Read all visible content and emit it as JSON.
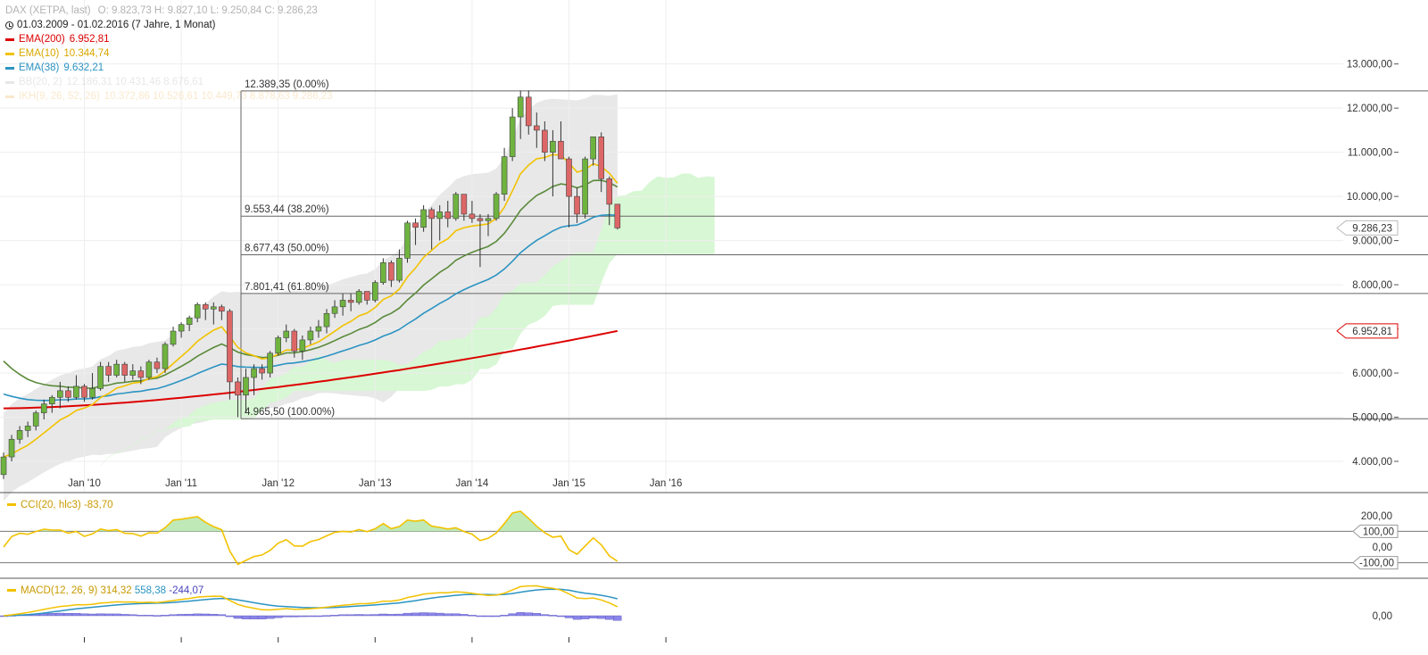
{
  "header": {
    "instrument": "DAX (XETPA, last)",
    "ohlc": "O: 9.823,73  H: 9.827,10  L: 9.250,84  C: 9.286,23",
    "range": "01.03.2009 - 01.02.2016 (7 Jahre, 1 Monat)"
  },
  "legend": [
    {
      "label": "EMA(200)",
      "value": "6.952,81",
      "color": "#dd0000",
      "faded": false
    },
    {
      "label": "EMA(10)",
      "value": "10.344,74",
      "color": "#f2c200",
      "faded": false
    },
    {
      "label": "EMA(38)",
      "value": "9.632,21",
      "color": "#2b93c2",
      "faded": false
    },
    {
      "label": "BB(20, 2)",
      "value": "12.186,31  10.431,46  8.676,61",
      "color": "#bbbbbb",
      "faded": true
    },
    {
      "label": "IKH(9, 26, 52, 26)",
      "value": "10.372,86  10.526,61  10.449,73  8.878,63  9.286,23",
      "color": "#f0c070",
      "faded": true
    }
  ],
  "price_tags": {
    "last": "9.286,23",
    "ema200": "6.952,81"
  },
  "cci": {
    "label": "CCI(20, hlc3)",
    "value": "-83,70",
    "ticks": [
      "200,00",
      "0,00"
    ],
    "tag_hi": "100,00",
    "tag_lo": "-100,00"
  },
  "macd": {
    "label": "MACD(12, 26, 9)",
    "value1": "314,32",
    "value2": "558,38",
    "value3": "-244,07",
    "tick": "0,00"
  },
  "colors": {
    "up": "#6fb33f",
    "down": "#dd6666",
    "ema200": "#dd0000",
    "ema10": "#f2c200",
    "ema38": "#2b93c2",
    "green_line": "#5a8a3a",
    "bb": "#e6e6e6",
    "cloud_up": "#d8f7d4",
    "cloud_down": "#f6d2d2",
    "macd_hist": "#8a85e8",
    "macd_signal": "#2b93c2",
    "cci_fill": "#b8e8b0"
  },
  "chart_data": {
    "type": "candlestick",
    "interval": "monthly",
    "y_ticks": [
      "13.000,00",
      "12.000,00",
      "11.000,00",
      "10.000,00",
      "9.000,00",
      "8.000,00",
      "7.000,00",
      "6.000,00",
      "5.000,00",
      "4.000,00"
    ],
    "y_tick_values": [
      13000,
      12000,
      11000,
      10000,
      9000,
      8000,
      7000,
      6000,
      5000,
      4000
    ],
    "x_labels": [
      "Jan '10",
      "Jan '11",
      "Jan '12",
      "Jan '13",
      "Jan '14",
      "Jan '15",
      "Jan '16"
    ],
    "x_label_month_index": [
      10,
      22,
      34,
      46,
      58,
      70,
      82
    ],
    "fibonacci": [
      {
        "label": "12.389,35 (0.00%)",
        "value": 12389.35
      },
      {
        "label": "9.553,44 (38.20%)",
        "value": 9553.44
      },
      {
        "label": "8.677,43 (50.00%)",
        "value": 8677.43
      },
      {
        "label": "7.801,41 (61.80%)",
        "value": 7801.41
      },
      {
        "label": "4.965,50 (100.00%)",
        "value": 4965.5
      }
    ],
    "candles": [
      [
        3700,
        4200,
        3600,
        4100
      ],
      [
        4100,
        4600,
        4000,
        4500
      ],
      [
        4500,
        4800,
        4400,
        4700
      ],
      [
        4700,
        4900,
        4550,
        4800
      ],
      [
        4800,
        5150,
        4700,
        5100
      ],
      [
        5100,
        5400,
        4950,
        5300
      ],
      [
        5300,
        5500,
        5100,
        5450
      ],
      [
        5450,
        5800,
        5200,
        5600
      ],
      [
        5600,
        5700,
        5350,
        5450
      ],
      [
        5450,
        5950,
        5400,
        5700
      ],
      [
        5700,
        5750,
        5350,
        5450
      ],
      [
        5450,
        6000,
        5400,
        5650
      ],
      [
        5650,
        6250,
        5600,
        6150
      ],
      [
        6150,
        6250,
        5800,
        5950
      ],
      [
        5950,
        6300,
        5900,
        6200
      ],
      [
        6200,
        6250,
        5800,
        5950
      ],
      [
        5950,
        6200,
        5850,
        6050
      ],
      [
        6050,
        6150,
        5750,
        5900
      ],
      [
        5900,
        6300,
        5850,
        6250
      ],
      [
        6250,
        6350,
        6000,
        6100
      ],
      [
        6100,
        6700,
        6000,
        6650
      ],
      [
        6650,
        7050,
        6600,
        6950
      ],
      [
        6950,
        7150,
        6800,
        7100
      ],
      [
        7100,
        7300,
        6950,
        7250
      ],
      [
        7250,
        7600,
        7150,
        7550
      ],
      [
        7550,
        7600,
        7200,
        7450
      ],
      [
        7450,
        7600,
        7100,
        7500
      ],
      [
        7500,
        7550,
        7200,
        7400
      ],
      [
        7400,
        7450,
        5400,
        5800
      ],
      [
        5800,
        5900,
        5000,
        5500
      ],
      [
        5500,
        6100,
        5100,
        5900
      ],
      [
        5900,
        6200,
        5500,
        6100
      ],
      [
        6100,
        6200,
        5850,
        6000
      ],
      [
        6000,
        6500,
        5900,
        6450
      ],
      [
        6450,
        6850,
        6400,
        6800
      ],
      [
        6800,
        7100,
        6700,
        6950
      ],
      [
        6950,
        7000,
        6350,
        6500
      ],
      [
        6500,
        6850,
        6300,
        6750
      ],
      [
        6750,
        7050,
        6650,
        6950
      ],
      [
        6950,
        7200,
        6800,
        7050
      ],
      [
        7050,
        7450,
        6900,
        7350
      ],
      [
        7350,
        7650,
        7250,
        7500
      ],
      [
        7500,
        7800,
        7300,
        7650
      ],
      [
        7650,
        7800,
        7400,
        7600
      ],
      [
        7600,
        7900,
        7550,
        7850
      ],
      [
        7850,
        7850,
        7550,
        7650
      ],
      [
        7650,
        8100,
        7600,
        8050
      ],
      [
        8050,
        8600,
        8000,
        8500
      ],
      [
        8500,
        8550,
        7950,
        8100
      ],
      [
        8100,
        8800,
        8050,
        8600
      ],
      [
        8600,
        9450,
        8500,
        9400
      ],
      [
        9400,
        9500,
        8900,
        9300
      ],
      [
        9300,
        9800,
        9200,
        9700
      ],
      [
        9700,
        9750,
        8800,
        9500
      ],
      [
        9500,
        9800,
        9000,
        9650
      ],
      [
        9650,
        9900,
        9300,
        9500
      ],
      [
        9500,
        10100,
        9450,
        10050
      ],
      [
        10050,
        10050,
        9450,
        9600
      ],
      [
        9600,
        9900,
        9400,
        9500
      ],
      [
        9500,
        9600,
        8400,
        9450
      ],
      [
        9450,
        9600,
        9100,
        9500
      ],
      [
        9500,
        10100,
        9450,
        10050
      ],
      [
        10050,
        11100,
        9900,
        10900
      ],
      [
        10900,
        12000,
        10800,
        11800
      ],
      [
        11800,
        12400,
        11300,
        12250
      ],
      [
        12250,
        12400,
        11400,
        11600
      ],
      [
        11600,
        11900,
        11100,
        11500
      ],
      [
        11500,
        11700,
        10800,
        11000
      ],
      [
        11000,
        11500,
        10000,
        11250
      ],
      [
        11250,
        11700,
        10900,
        10850
      ],
      [
        10850,
        10900,
        9300,
        10000
      ],
      [
        10000,
        10200,
        9400,
        9600
      ],
      [
        9600,
        10900,
        9500,
        10850
      ],
      [
        10850,
        11300,
        10700,
        11350
      ],
      [
        11350,
        11450,
        10100,
        10400
      ],
      [
        10400,
        10450,
        9350,
        9823
      ],
      [
        9823.73,
        9827.1,
        9250.84,
        9286.23
      ]
    ],
    "ema200_start": 5200,
    "ema200_end": 6952.81,
    "ema10_last": 10344.74,
    "ema38_last": 9632.21,
    "bb_last": [
      12186.31,
      10431.46,
      8676.61
    ]
  }
}
